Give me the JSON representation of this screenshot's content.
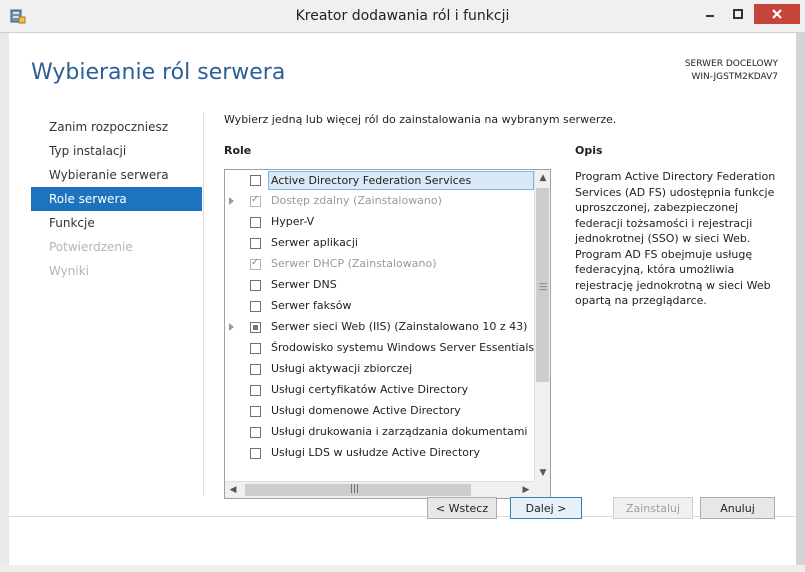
{
  "window": {
    "title": "Kreator dodawania ról i funkcji"
  },
  "page": {
    "title": "Wybieranie ról serwera",
    "server_label": "SERWER DOCELOWY",
    "server_name": "WIN-JGSTM2KDAV7",
    "instruction": "Wybierz jedną lub więcej ról do zainstalowania na wybranym serwerze."
  },
  "nav": {
    "items": [
      {
        "label": "Zanim rozpoczniesz",
        "state": "normal"
      },
      {
        "label": "Typ instalacji",
        "state": "normal"
      },
      {
        "label": "Wybieranie serwera",
        "state": "normal"
      },
      {
        "label": "Role serwera",
        "state": "active"
      },
      {
        "label": "Funkcje",
        "state": "normal"
      },
      {
        "label": "Potwierdzenie",
        "state": "disabled"
      },
      {
        "label": "Wyniki",
        "state": "disabled"
      }
    ]
  },
  "roles": {
    "header": "Role",
    "items": [
      {
        "label": "Active Directory Federation Services",
        "checkbox": "unchecked",
        "expander": false,
        "selected": true
      },
      {
        "label": "Dostęp zdalny (Zainstalowano)",
        "checkbox": "checked-disabled",
        "expander": true,
        "selected": false
      },
      {
        "label": "Hyper-V",
        "checkbox": "unchecked",
        "expander": false,
        "selected": false
      },
      {
        "label": "Serwer aplikacji",
        "checkbox": "unchecked",
        "expander": false,
        "selected": false
      },
      {
        "label": "Serwer DHCP (Zainstalowano)",
        "checkbox": "checked-disabled",
        "expander": false,
        "selected": false
      },
      {
        "label": "Serwer DNS",
        "checkbox": "unchecked",
        "expander": false,
        "selected": false
      },
      {
        "label": "Serwer faksów",
        "checkbox": "unchecked",
        "expander": false,
        "selected": false
      },
      {
        "label": "Serwer sieci Web (IIS) (Zainstalowano 10 z 43)",
        "checkbox": "partial",
        "expander": true,
        "selected": false
      },
      {
        "label": "Środowisko systemu Windows Server Essentials",
        "checkbox": "unchecked",
        "expander": false,
        "selected": false
      },
      {
        "label": "Usługi aktywacji zbiorczej",
        "checkbox": "unchecked",
        "expander": false,
        "selected": false
      },
      {
        "label": "Usługi certyfikatów Active Directory",
        "checkbox": "unchecked",
        "expander": false,
        "selected": false
      },
      {
        "label": "Usługi domenowe Active Directory",
        "checkbox": "unchecked",
        "expander": false,
        "selected": false
      },
      {
        "label": "Usługi drukowania i zarządzania dokumentami",
        "checkbox": "unchecked",
        "expander": false,
        "selected": false
      },
      {
        "label": "Usługi LDS w usłudze Active Directory",
        "checkbox": "unchecked",
        "expander": false,
        "selected": false
      }
    ]
  },
  "description": {
    "header": "Opis",
    "text": "Program Active Directory Federation Services (AD FS) udostępnia funkcje uproszczonej, zabezpieczonej federacji tożsamości i rejestracji jednokrotnej (SSO) w sieci Web. Program AD FS obejmuje usługę federacyjną, która umożliwia rejestrację jednokrotną w sieci Web opartą na przeglądarce."
  },
  "buttons": {
    "back": "< Wstecz",
    "next": "Dalej >",
    "install": "Zainstaluj",
    "cancel": "Anuluj"
  },
  "colors": {
    "accent": "#1e73be",
    "title_blue": "#2d5f96",
    "close_red": "#c7443a"
  }
}
